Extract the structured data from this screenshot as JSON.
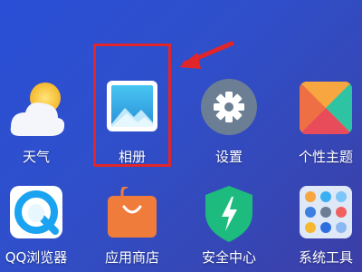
{
  "colors": {
    "accent_highlight": "#e0262a",
    "arrow": "#e0262a",
    "wallpaper_top": "#2a4fd6",
    "wallpaper_bottom": "#3c3ea6"
  },
  "apps": [
    {
      "label": "天气",
      "icon": "weather-icon"
    },
    {
      "label": "相册",
      "icon": "gallery-icon"
    },
    {
      "label": "设置",
      "icon": "settings-gear-icon"
    },
    {
      "label": "个性主题",
      "icon": "themes-icon"
    },
    {
      "label": "QQ浏览器",
      "icon": "qq-browser-icon"
    },
    {
      "label": "应用商店",
      "icon": "app-store-bag-icon"
    },
    {
      "label": "安全中心",
      "icon": "security-shield-icon"
    },
    {
      "label": "系统工具",
      "icon": "system-tools-folder-icon"
    }
  ]
}
